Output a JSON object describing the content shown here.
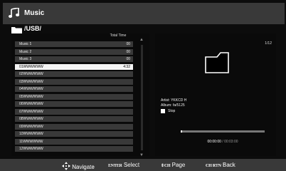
{
  "header": {
    "title": "Music",
    "icon": "music-note-icon"
  },
  "path": {
    "text": "/USB/",
    "icon": "folder-icon"
  },
  "list": {
    "column_header": "Total Time",
    "selected_index": 3,
    "rows": [
      {
        "name": "Music 1",
        "time": "00"
      },
      {
        "name": "Music 2",
        "time": "00"
      },
      {
        "name": "Music 3",
        "time": "00"
      },
      {
        "name": "01WWWWWW",
        "time": "4:32"
      },
      {
        "name": "02WWWWWW",
        "time": ""
      },
      {
        "name": "03WWWWWW",
        "time": ""
      },
      {
        "name": "04WWWWWW",
        "time": ""
      },
      {
        "name": "05WWWWWW",
        "time": ""
      },
      {
        "name": "06WWWWWW",
        "time": ""
      },
      {
        "name": "07WWWWWW",
        "time": ""
      },
      {
        "name": "08WWWWWW",
        "time": ""
      },
      {
        "name": "09WWWWWW",
        "time": ""
      },
      {
        "name": "10WWWWWW",
        "time": ""
      },
      {
        "name": "11WWWWWW",
        "time": ""
      },
      {
        "name": "12WWWWWW",
        "time": ""
      }
    ]
  },
  "info": {
    "page_count": "1/12",
    "artist": "Artist: YKKCD H",
    "album": "Album: fa/5125",
    "stop_label": "Stop",
    "progress": 0.02,
    "time_current": "00:00:00",
    "time_total": "/ 00:03:00"
  },
  "footer": {
    "navigate": {
      "key": "",
      "label": "Navigate"
    },
    "select": {
      "key": "ENTER",
      "label": "Select"
    },
    "page": {
      "key": "CH",
      "label": "Page"
    },
    "back": {
      "key": "CH RTN",
      "label": "Back"
    }
  },
  "colors": {
    "background": "#0c0c0c",
    "panel": "#0a0a0a",
    "selection": "#f4f4f4",
    "dither": "#2b2b2b"
  }
}
